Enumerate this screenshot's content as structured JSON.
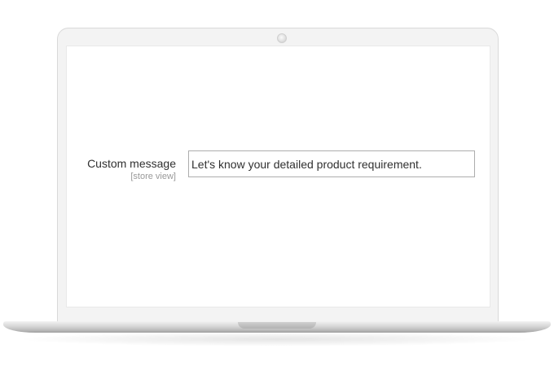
{
  "form": {
    "custom_message": {
      "label": "Custom message",
      "scope": "[store view]",
      "value": "Let's know your detailed product requirement."
    }
  },
  "colors": {
    "label_text": "#303030",
    "scope_text": "#999999",
    "input_border": "#adadad",
    "laptop_frame": "#f3f3f3"
  }
}
